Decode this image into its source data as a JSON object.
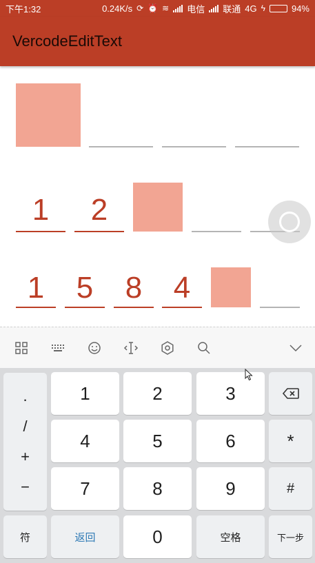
{
  "status_bar": {
    "time": "下午1:32",
    "speed": "0.24K/s",
    "carrier1": "电信",
    "carrier2": "联通",
    "network": "4G",
    "battery_percent": "94%",
    "battery_level": 0.94,
    "icons": [
      "sync-icon",
      "alarm-icon",
      "wifi-icon",
      "signal-icon",
      "charging-icon",
      "battery-icon"
    ]
  },
  "app_bar": {
    "title": "VercodeEditText"
  },
  "code_rows": [
    {
      "digits": [
        "",
        "",
        "",
        ""
      ],
      "active_index": 0
    },
    {
      "digits": [
        "1",
        "2",
        "",
        "",
        ""
      ],
      "active_index": 2
    },
    {
      "digits": [
        "1",
        "5",
        "8",
        "4",
        "",
        ""
      ],
      "active_index": 4
    }
  ],
  "colors": {
    "primary": "#bb3e26",
    "active_box": "#f2a593",
    "inactive_line": "#b4b4b4",
    "keyboard_bg": "#d9dadc"
  },
  "keyboard": {
    "toolbar_icons": [
      "grid-icon",
      "keyboard-icon",
      "emoji-icon",
      "cursor-icon",
      "settings-icon",
      "search-icon",
      "collapse-icon"
    ],
    "symbols": [
      ".",
      "/",
      "+",
      "−"
    ],
    "digits": [
      "1",
      "2",
      "3",
      "4",
      "5",
      "6",
      "7",
      "8",
      "9",
      "0"
    ],
    "backspace_icon": "backspace-icon",
    "star": "*",
    "hash": "#",
    "symbol_key": "符",
    "back_key": "返回",
    "space_key": "空格",
    "next_key": "下一步"
  }
}
